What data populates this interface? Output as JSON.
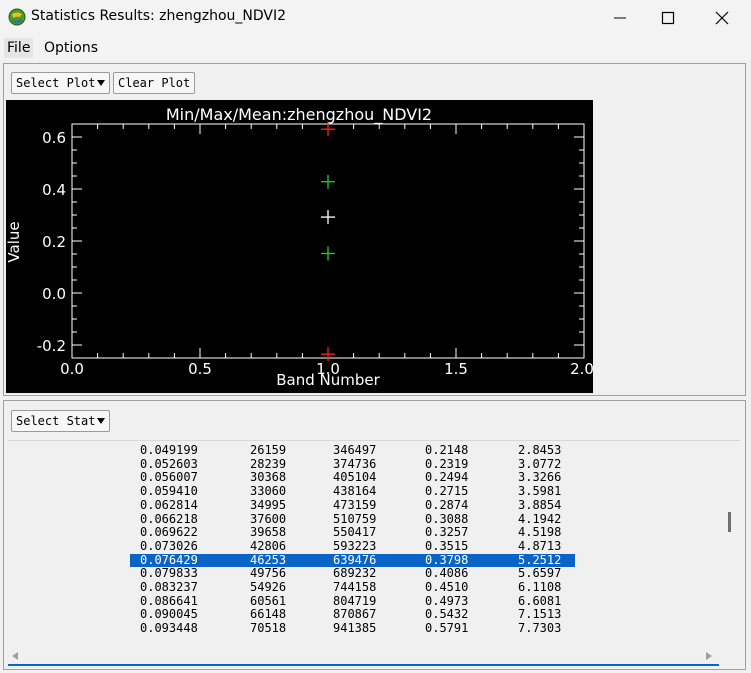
{
  "window": {
    "title": "Statistics Results: zhengzhou_NDVI2"
  },
  "menu": {
    "items": [
      "File",
      "Options"
    ]
  },
  "toolbar": {
    "select_plot": "Select Plot",
    "clear_plot": "Clear Plot",
    "select_stat": "Select Stat"
  },
  "icons": {
    "app": "globe-icon",
    "minimize": "minimize-icon",
    "maximize": "maximize-icon",
    "close": "close-icon",
    "dropdown": "chevron-down-icon"
  },
  "colors": {
    "plot_background": "#000000",
    "axis": "#ffffff",
    "min_max_marker": "#ff2020",
    "stdev_marker": "#20d020",
    "mean_marker": "#ffffff",
    "selected_row": "#0a64c8"
  },
  "chart_data": {
    "type": "scatter",
    "title": "Min/Max/Mean:zhengzhou_NDVI2",
    "xlabel": "Band Number",
    "ylabel": "Value",
    "xlim": [
      0.0,
      2.0
    ],
    "ylim": [
      -0.25,
      0.65
    ],
    "x_ticks": [
      "0.0",
      "0.5",
      "1.0",
      "1.5",
      "2.0"
    ],
    "y_ticks": [
      "-0.2",
      "0.0",
      "0.2",
      "0.4",
      "0.6"
    ],
    "x_tick_values": [
      0.0,
      0.5,
      1.0,
      1.5,
      2.0
    ],
    "y_tick_values": [
      -0.2,
      0.0,
      0.2,
      0.4,
      0.6
    ],
    "points": [
      {
        "x": 1.0,
        "y": 0.63,
        "color": "#ff2020"
      },
      {
        "x": 1.0,
        "y": 0.428,
        "color": "#20d020"
      },
      {
        "x": 1.0,
        "y": 0.292,
        "color": "#ffffff"
      },
      {
        "x": 1.0,
        "y": 0.152,
        "color": "#20d020"
      },
      {
        "x": 1.0,
        "y": -0.235,
        "color": "#ff2020"
      }
    ]
  },
  "table": {
    "selected_index": 8,
    "rows": [
      [
        "0.049199",
        "26159",
        "346497",
        "0.2148",
        "2.8453"
      ],
      [
        "0.052603",
        "28239",
        "374736",
        "0.2319",
        "3.0772"
      ],
      [
        "0.056007",
        "30368",
        "405104",
        "0.2494",
        "3.3266"
      ],
      [
        "0.059410",
        "33060",
        "438164",
        "0.2715",
        "3.5981"
      ],
      [
        "0.062814",
        "34995",
        "473159",
        "0.2874",
        "3.8854"
      ],
      [
        "0.066218",
        "37600",
        "510759",
        "0.3088",
        "4.1942"
      ],
      [
        "0.069622",
        "39658",
        "550417",
        "0.3257",
        "4.5198"
      ],
      [
        "0.073026",
        "42806",
        "593223",
        "0.3515",
        "4.8713"
      ],
      [
        "0.076429",
        "46253",
        "639476",
        "0.3798",
        "5.2512"
      ],
      [
        "0.079833",
        "49756",
        "689232",
        "0.4086",
        "5.6597"
      ],
      [
        "0.083237",
        "54926",
        "744158",
        "0.4510",
        "6.1108"
      ],
      [
        "0.086641",
        "60561",
        "804719",
        "0.4973",
        "6.6081"
      ],
      [
        "0.090045",
        "66148",
        "870867",
        "0.5432",
        "7.1513"
      ],
      [
        "0.093448",
        "70518",
        "941385",
        "0.5791",
        "7.7303"
      ]
    ]
  }
}
